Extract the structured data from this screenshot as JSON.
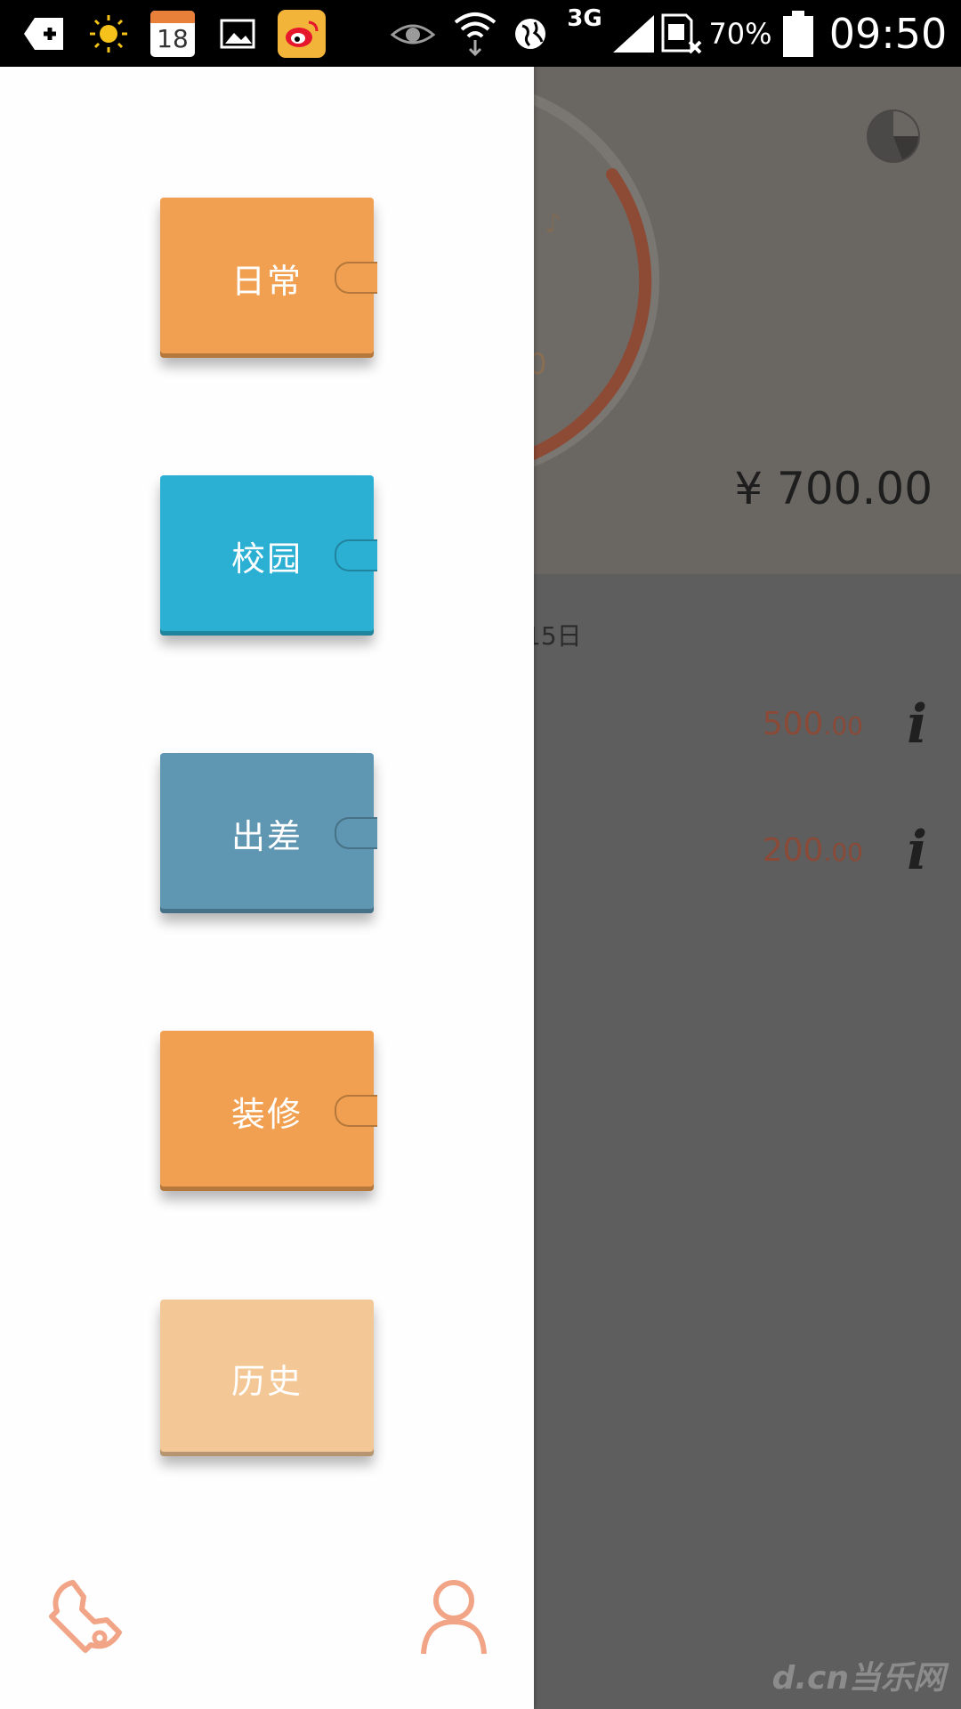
{
  "status_bar": {
    "calendar_day": "18",
    "network": "3G",
    "battery": "70%",
    "time": "09:50"
  },
  "background_app": {
    "total": "¥ 700.00",
    "date_fragment": "15日",
    "circle_fragment": "0",
    "entries": [
      {
        "amount_main": "500",
        "amount_cents": ".00"
      },
      {
        "amount_main": "200",
        "amount_cents": ".00"
      }
    ],
    "info_glyph": "i",
    "watermark": "d.cn当乐网"
  },
  "drawer": {
    "books": [
      {
        "label": "日常",
        "color": "#f0a050"
      },
      {
        "label": "校园",
        "color": "#2bb0d4"
      },
      {
        "label": "出差",
        "color": "#5f97b3"
      },
      {
        "label": "装修",
        "color": "#f0a050"
      },
      {
        "label": "历史",
        "color": "#f3c896"
      }
    ],
    "accent_color": "#f2a487"
  }
}
